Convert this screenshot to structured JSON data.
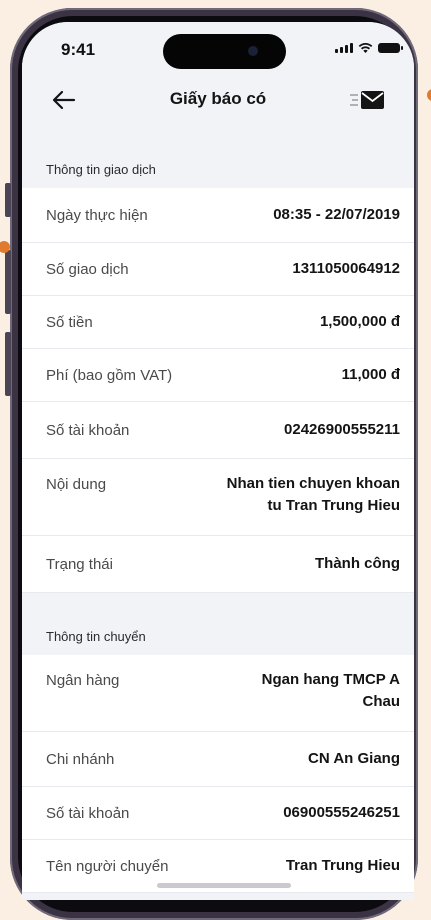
{
  "status_bar": {
    "time": "9:41"
  },
  "header": {
    "title": "Giấy báo có"
  },
  "sections": [
    {
      "title": "Thông tin giao dịch",
      "rows": [
        {
          "label": "Ngày thực hiện",
          "value": "08:35 - 22/07/2019"
        },
        {
          "label": "Số giao dịch",
          "value": "1311050064912"
        },
        {
          "label": "Số tiền",
          "value": "1,500,000 đ"
        },
        {
          "label": "Phí (bao gồm VAT)",
          "value": "11,000 đ"
        },
        {
          "label": "Số tài khoản",
          "value": "02426900555211"
        },
        {
          "label": "Nội dung",
          "value": "Nhan tien chuyen khoan",
          "value2": "tu Tran Trung Hieu"
        },
        {
          "label": "Trạng thái",
          "value": "Thành công"
        }
      ]
    },
    {
      "title": "Thông tin chuyển",
      "rows": [
        {
          "label": "Ngân hàng",
          "value": "Ngan hang TMCP A",
          "value2": "Chau"
        },
        {
          "label": "Chi nhánh",
          "value": "CN An Giang"
        },
        {
          "label": "Số tài khoản",
          "value": "06900555246251"
        },
        {
          "label": "Tên người chuyển",
          "value": "Tran Trung Hieu"
        }
      ]
    }
  ],
  "icons": {
    "back": "arrow-left-icon",
    "mail": "envelope-icon"
  },
  "colors": {
    "background": "#f2f3f7",
    "accent": "#e07a2f"
  }
}
